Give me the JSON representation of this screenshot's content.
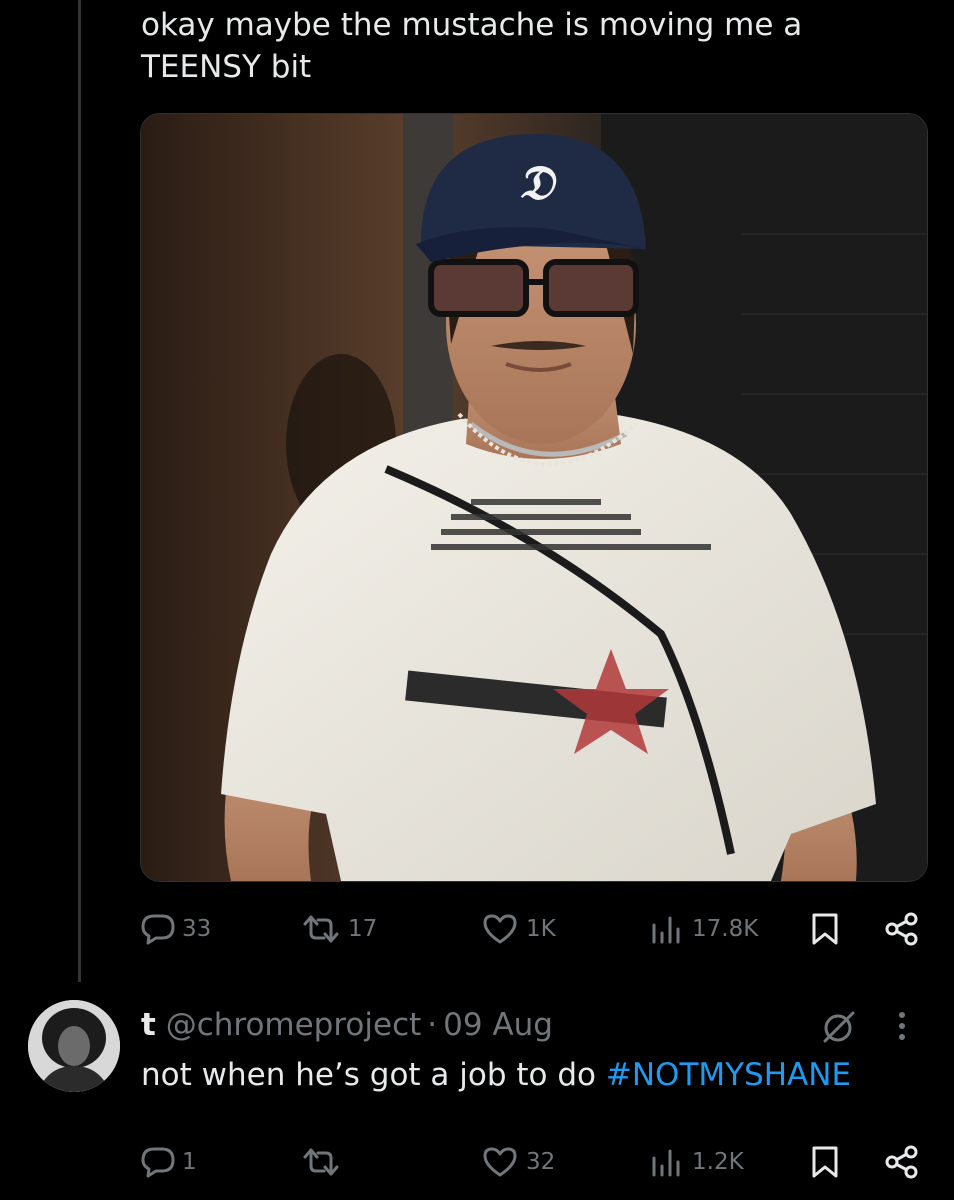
{
  "tweet": {
    "text_line1": "okay maybe the mustache is moving me a",
    "text_line2": "TEENSY bit",
    "media_icon": "photo-of-man-in-cap-glasses-white-tshirt",
    "actions": {
      "replies": "33",
      "reposts": "17",
      "likes": "1K",
      "views": "17.8K"
    }
  },
  "reply": {
    "name": "t",
    "handle": "@chromeproject",
    "separator": "·",
    "date": "09 Aug",
    "body_text": "not when he’s got a job to do",
    "hashtag": "#NOTMYSHANE",
    "actions": {
      "replies": "1",
      "reposts": "",
      "likes": "32",
      "views": "1.2K"
    }
  },
  "icons": {
    "reply": "speech-bubble-icon",
    "repost": "repost-arrows-icon",
    "like": "heart-icon",
    "views": "bar-chart-icon",
    "bookmark": "bookmark-icon",
    "share": "share-icon",
    "grok": "slash-circle-icon",
    "more": "vertical-dots-icon"
  },
  "colors": {
    "background": "#000000",
    "text": "#e7e9ea",
    "muted": "#71767b",
    "link": "#1d9bf0",
    "thread_line": "#333639"
  }
}
